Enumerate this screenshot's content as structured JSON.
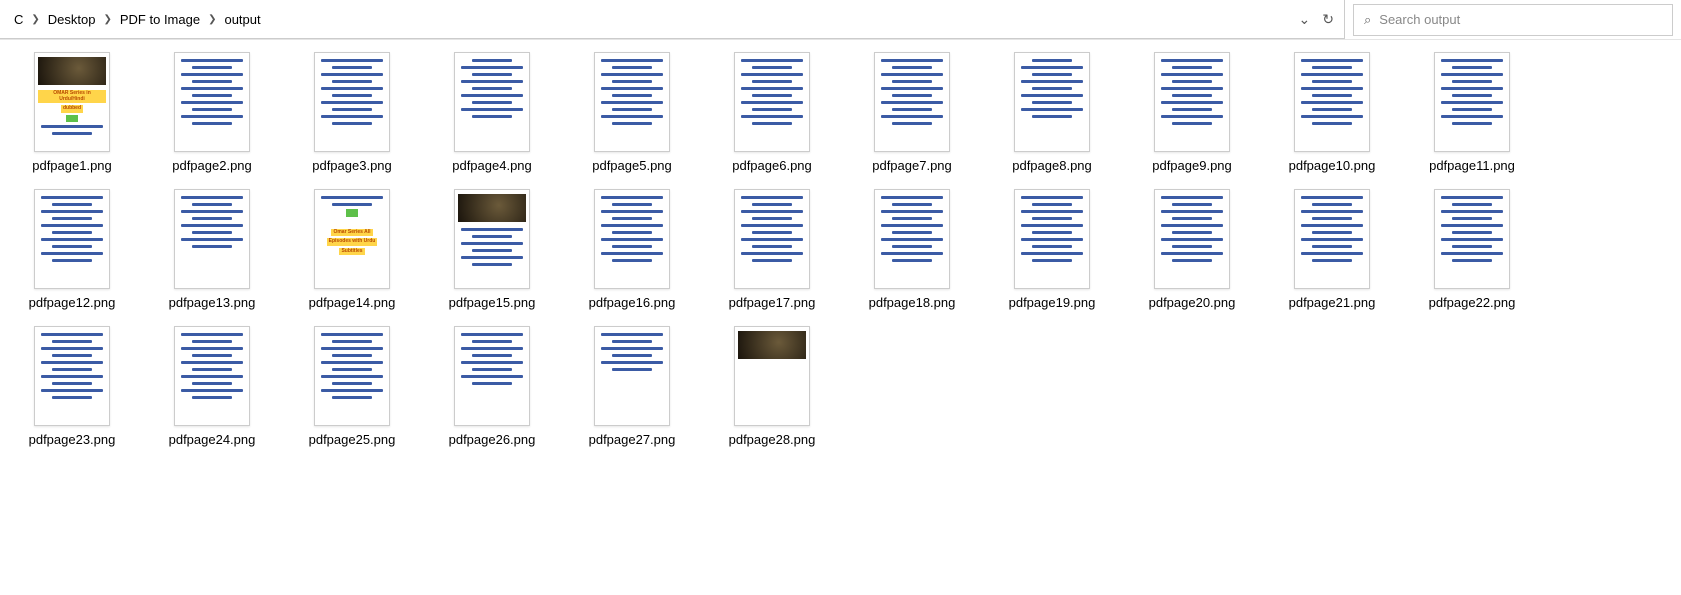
{
  "breadcrumbs": {
    "a": "C",
    "b": "Desktop",
    "c": "PDF to Image",
    "d": "output"
  },
  "search": {
    "placeholder": "Search output"
  },
  "files": {
    "f1": "pdfpage1.png",
    "f2": "pdfpage2.png",
    "f3": "pdfpage3.png",
    "f4": "pdfpage4.png",
    "f5": "pdfpage5.png",
    "f6": "pdfpage6.png",
    "f7": "pdfpage7.png",
    "f8": "pdfpage8.png",
    "f9": "pdfpage9.png",
    "f10": "pdfpage10.png",
    "f11": "pdfpage11.png",
    "f12": "pdfpage12.png",
    "f13": "pdfpage13.png",
    "f14": "pdfpage14.png",
    "f15": "pdfpage15.png",
    "f16": "pdfpage16.png",
    "f17": "pdfpage17.png",
    "f18": "pdfpage18.png",
    "f19": "pdfpage19.png",
    "f20": "pdfpage20.png",
    "f21": "pdfpage21.png",
    "f22": "pdfpage22.png",
    "f23": "pdfpage23.png",
    "f24": "pdfpage24.png",
    "f25": "pdfpage25.png",
    "f26": "pdfpage26.png",
    "f27": "pdfpage27.png",
    "f28": "pdfpage28.png"
  },
  "thumbtext": {
    "t1a": "OMAR Series in Urdu/Hindi",
    "t1b": "dubbed",
    "t14a": "Omar Series All",
    "t14b": "Episodes with Urdu",
    "t14c": "Subtitles"
  }
}
